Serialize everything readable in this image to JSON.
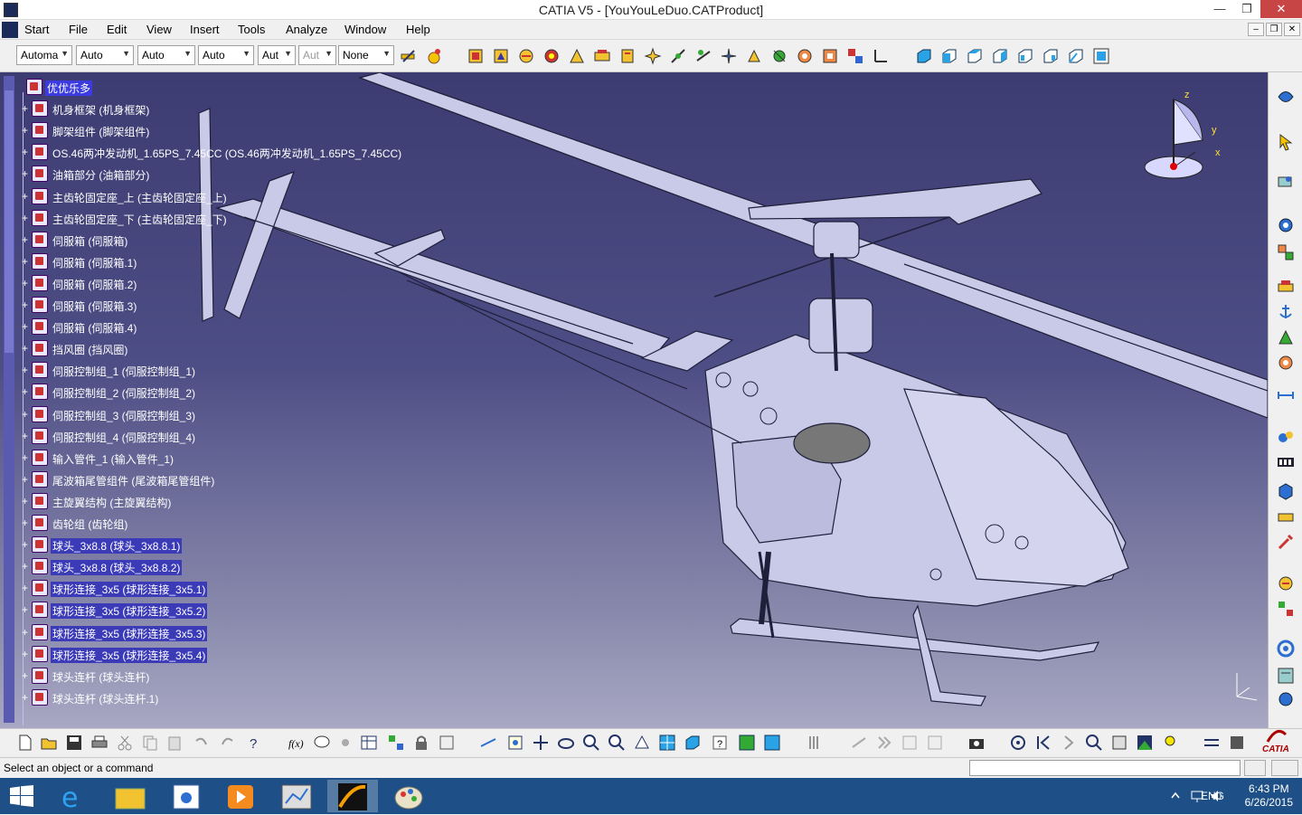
{
  "window": {
    "title": "CATIA V5 - [YouYouLeDuo.CATProduct]"
  },
  "menu": {
    "items": [
      "Start",
      "File",
      "Edit",
      "View",
      "Insert",
      "Tools",
      "Analyze",
      "Window",
      "Help"
    ]
  },
  "toolbar": {
    "combos": [
      "Automa",
      "Auto",
      "Auto",
      "Auto",
      "Aut",
      "Aut",
      "None"
    ]
  },
  "tree": {
    "root": "优优乐多",
    "items": [
      "机身框架 (机身框架)",
      "脚架组件 (脚架组件)",
      "OS.46两冲发动机_1.65PS_7.45CC (OS.46两冲发动机_1.65PS_7.45CC)",
      "油箱部分 (油箱部分)",
      "主齿轮固定座_上 (主齿轮固定座_上)",
      "主齿轮固定座_下 (主齿轮固定座_下)",
      "伺服箱 (伺服箱)",
      "伺服箱 (伺服箱.1)",
      "伺服箱 (伺服箱.2)",
      "伺服箱 (伺服箱.3)",
      "伺服箱 (伺服箱.4)",
      "挡风圈 (挡风圈)",
      "伺服控制组_1 (伺服控制组_1)",
      "伺服控制组_2 (伺服控制组_2)",
      "伺服控制组_3 (伺服控制组_3)",
      "伺服控制组_4 (伺服控制组_4)",
      "输入管件_1 (输入管件_1)",
      "尾波箱尾管组件 (尾波箱尾管组件)",
      "主旋翼结构 (主旋翼结构)",
      "齿轮组 (齿轮组)",
      "球头_3x8.8 (球头_3x8.8.1)",
      "球头_3x8.8 (球头_3x8.8.2)",
      "球形连接_3x5 (球形连接_3x5.1)",
      "球形连接_3x5 (球形连接_3x5.2)",
      "球形连接_3x5 (球形连接_3x5.3)",
      "球形连接_3x5 (球形连接_3x5.4)",
      "球头连杆 (球头连杆)",
      "球头连杆 (球头连杆.1)"
    ]
  },
  "compass": {
    "x": "x",
    "y": "y",
    "z": "z"
  },
  "status": {
    "message": "Select an object or a command"
  },
  "taskbar": {
    "lang": "ENG",
    "time": "6:43 PM",
    "date": "6/26/2015"
  },
  "logo": {
    "text": "CATIA"
  },
  "colors": {
    "viewport_top": "#3c3c72",
    "viewport_bottom": "#a8a8c4",
    "taskbar": "#1e4f86",
    "selection": "#3b3be0"
  }
}
